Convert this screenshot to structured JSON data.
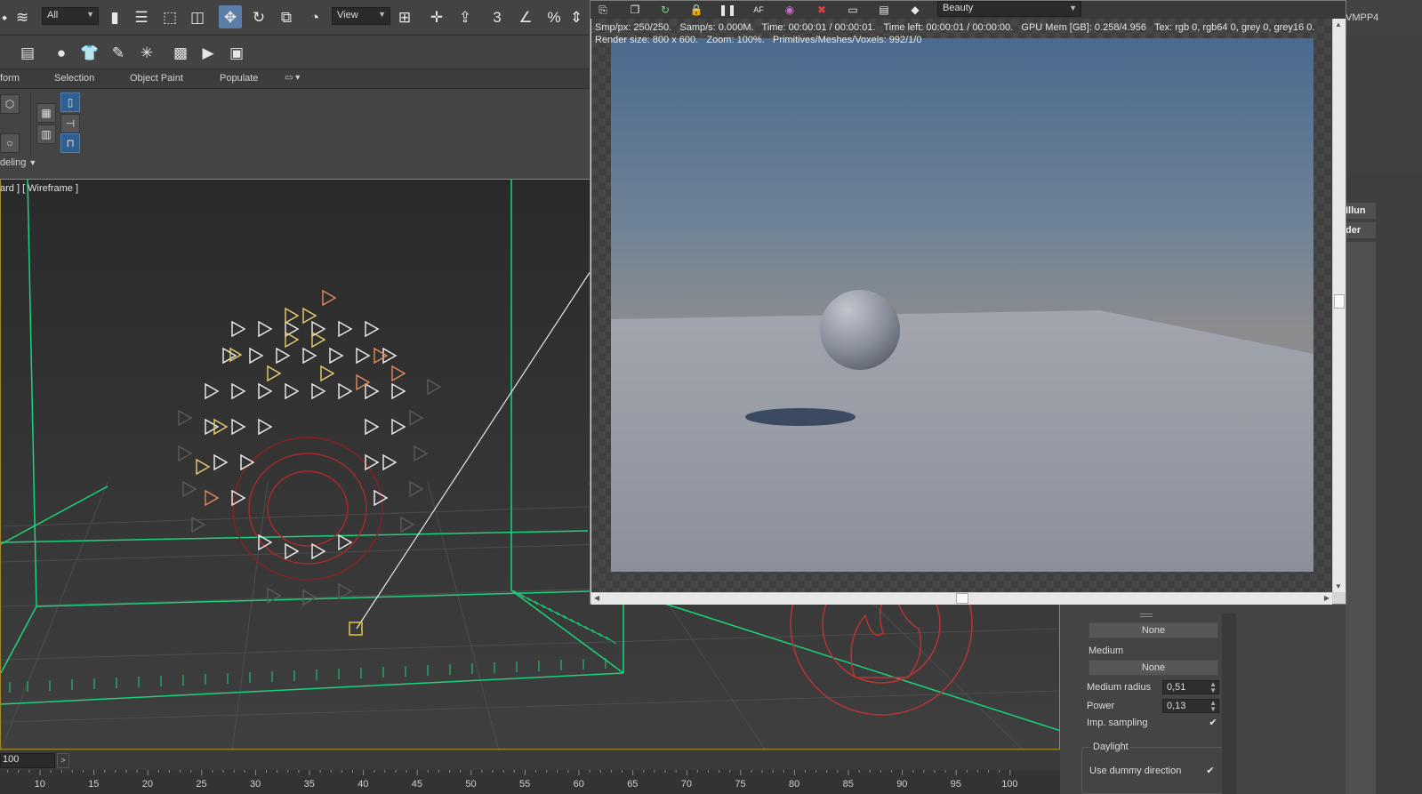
{
  "toolbar": {
    "selection_filter": "All",
    "ref_coord_system": "View",
    "snap_angle_label": "3",
    "percent_snap_label": "%"
  },
  "ribbon": {
    "tabs": [
      "form",
      "Selection",
      "Object Paint",
      "Populate"
    ],
    "subtab": "deling"
  },
  "viewport": {
    "label": "ard ] [ Wireframe ]"
  },
  "vfb": {
    "render_element": "Beauty",
    "info_line1": "Smp/px: 250/250.   Samp/s: 0.000M.   Time: 00:00:01 / 00:00:01.   Time left: 00:00:01 / 00:00:00.   GPU Mem [GB]: 0.258/4.956   Tex: rgb 0, rgb64 0, grey 0, grey16 0.",
    "info_line2": "Render size: 800 x 600.   Zoom: 100%.   Primitives/Meshes/Voxels: 992/1/0"
  },
  "right_panel": {
    "tab_label": "VMPP4",
    "items": [
      "Illun",
      "der"
    ]
  },
  "command_panel": {
    "environment_button": "None",
    "medium_label": "Medium",
    "medium_button": "None",
    "medium_radius_label": "Medium radius",
    "medium_radius_value": "0,51",
    "power_label": "Power",
    "power_value": "0,13",
    "imp_sampling_label": "Imp. sampling",
    "imp_sampling_checked": true,
    "daylight_group": "Daylight",
    "use_dummy_direction_label": "Use dummy direction",
    "use_dummy_direction_checked": true
  },
  "timeline": {
    "frame_field": "100",
    "next_button": ">",
    "ticks": [
      "10",
      "15",
      "20",
      "25",
      "30",
      "35",
      "40",
      "45",
      "50",
      "55",
      "60",
      "65",
      "70",
      "75",
      "80",
      "85",
      "90",
      "95",
      "100"
    ]
  },
  "colors": {
    "ui_bg": "#444444",
    "viewport_bg": "#383838",
    "viewport_border": "#a38a2a",
    "grid_green": "#19d67a",
    "active_blue": "#5b7ea8"
  },
  "icons": {
    "toolbar": [
      "select-object-icon",
      "select-by-name-icon",
      "rect-region-icon",
      "window-crossing-icon",
      "move-icon",
      "rotate-icon",
      "scale-icon",
      "place-icon",
      "pivot-icon",
      "snap-icon",
      "angle-snap-icon",
      "percent-snap-icon"
    ],
    "vfb": [
      "save-icon",
      "copy-icon",
      "refresh-icon",
      "lock-icon",
      "pause-icon",
      "af-icon",
      "color-wheel-icon",
      "stop-icon",
      "monitor-icon",
      "print-icon",
      "teapot-icon"
    ]
  }
}
